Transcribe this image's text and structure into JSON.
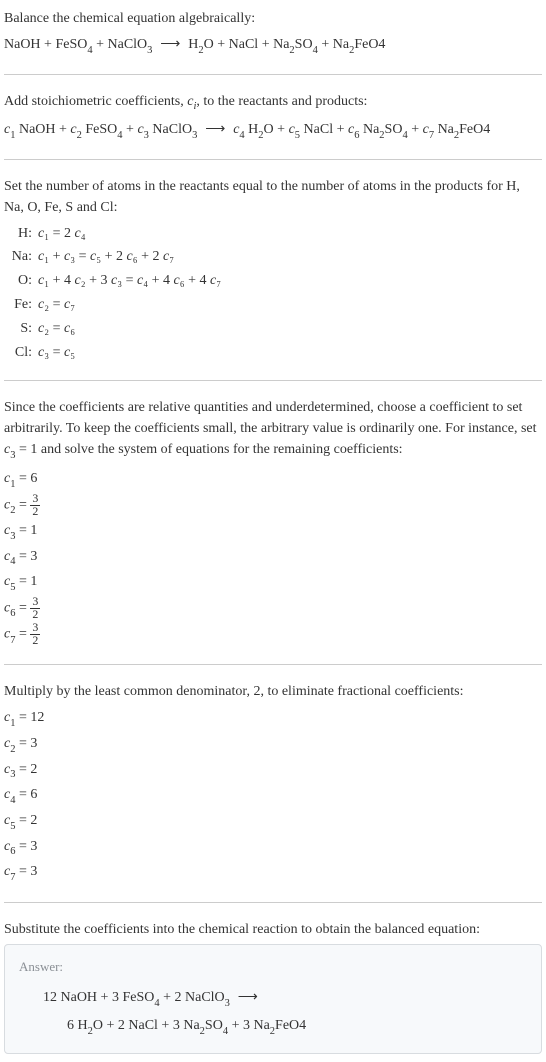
{
  "intro1": "Balance the chemical equation algebraically:",
  "eq1_lhs": "NaOH + FeSO",
  "eq1_feso4": "4",
  "eq1_plus1": " + NaClO",
  "eq1_naclo3": "3",
  "eq1_arrow": " ⟶ ",
  "eq1_h2o_h": "H",
  "eq1_h2o_2": "2",
  "eq1_h2o_o": "O + NaCl + Na",
  "eq1_na2_2": "2",
  "eq1_so": "SO",
  "eq1_so4": "4",
  "eq1_plus2": " + Na",
  "eq1_naf2": "2",
  "eq1_feo4": "FeO4",
  "intro2a": "Add stoichiometric coefficients, ",
  "intro2_ci": "c",
  "intro2_i": "i",
  "intro2b": ", to the reactants and products:",
  "c1": "c",
  "s1": "1",
  "naoh": " NaOH + ",
  "s2": "2",
  "feso": " FeSO",
  "s4": "4",
  "plus": " + ",
  "s3": "3",
  "naclo": " NaClO",
  "arrow": " ⟶ ",
  "h": " H",
  "o_nacl": "O + ",
  "s5": "5",
  "nacl_na": " NaCl + ",
  "s6": "6",
  "na": " Na",
  "so": "SO",
  "s7": "7",
  "feo4_2": "FeO4",
  "intro3": "Set the number of atoms in the reactants equal to the number of atoms in the products for H, Na, O, Fe, S and Cl:",
  "atoms": [
    {
      "label": "H:",
      "eq": "c₁ = 2 c₄"
    },
    {
      "label": "Na:",
      "eq": "c₁ + c₃ = c₅ + 2 c₆ + 2 c₇"
    },
    {
      "label": "O:",
      "eq": "c₁ + 4 c₂ + 3 c₃ = c₄ + 4 c₆ + 4 c₇"
    },
    {
      "label": "Fe:",
      "eq": "c₂ = c₇"
    },
    {
      "label": "S:",
      "eq": "c₂ = c₆"
    },
    {
      "label": "Cl:",
      "eq": "c₃ = c₅"
    }
  ],
  "intro4a": "Since the coefficients are relative quantities and underdetermined, choose a coefficient to set arbitrarily. To keep the coefficients small, the arbitrary value is ordinarily one. For instance, set ",
  "intro4_c3": "c",
  "intro4_3": "3",
  "intro4b": " = 1 and solve the system of equations for the remaining coefficients:",
  "coefs1": [
    {
      "var": "c",
      "sub": "1",
      "val": " = 6",
      "frac": null
    },
    {
      "var": "c",
      "sub": "2",
      "val": " = ",
      "frac": {
        "num": "3",
        "den": "2"
      }
    },
    {
      "var": "c",
      "sub": "3",
      "val": " = 1",
      "frac": null
    },
    {
      "var": "c",
      "sub": "4",
      "val": " = 3",
      "frac": null
    },
    {
      "var": "c",
      "sub": "5",
      "val": " = 1",
      "frac": null
    },
    {
      "var": "c",
      "sub": "6",
      "val": " = ",
      "frac": {
        "num": "3",
        "den": "2"
      }
    },
    {
      "var": "c",
      "sub": "7",
      "val": " = ",
      "frac": {
        "num": "3",
        "den": "2"
      }
    }
  ],
  "intro5": "Multiply by the least common denominator, 2, to eliminate fractional coefficients:",
  "coefs2": [
    {
      "var": "c",
      "sub": "1",
      "val": " = 12"
    },
    {
      "var": "c",
      "sub": "2",
      "val": " = 3"
    },
    {
      "var": "c",
      "sub": "3",
      "val": " = 2"
    },
    {
      "var": "c",
      "sub": "4",
      "val": " = 6"
    },
    {
      "var": "c",
      "sub": "5",
      "val": " = 2"
    },
    {
      "var": "c",
      "sub": "6",
      "val": " = 3"
    },
    {
      "var": "c",
      "sub": "7",
      "val": " = 3"
    }
  ],
  "intro6": "Substitute the coefficients into the chemical reaction to obtain the balanced equation:",
  "answer_label": "Answer:",
  "ans_line1_a": "12 NaOH + 3 FeSO",
  "ans_line1_b": " + 2 NaClO",
  "ans_arrow": " ⟶",
  "ans_line2_a": "6 H",
  "ans_line2_b": "O + 2 NaCl + 3 Na",
  "ans_line2_c": "SO",
  "ans_line2_d": " + 3 Na",
  "ans_line2_e": "FeO4"
}
